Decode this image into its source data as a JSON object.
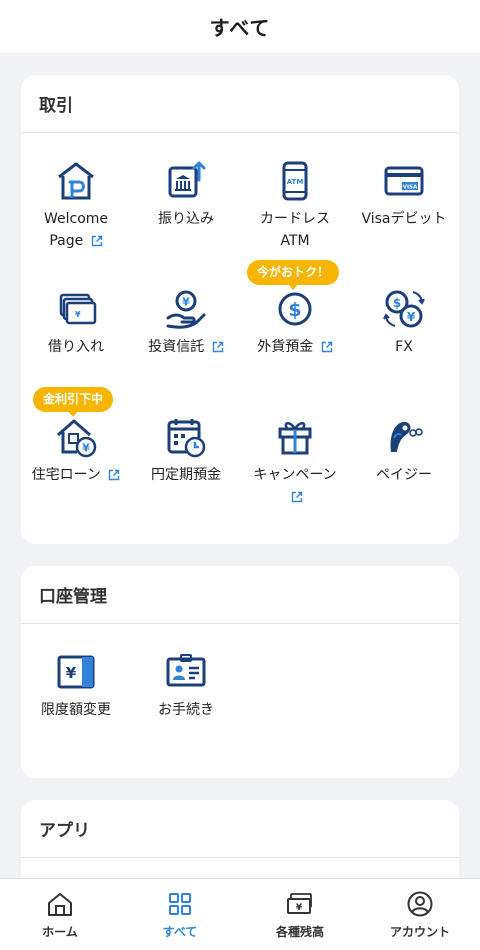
{
  "header": {
    "title": "すべて"
  },
  "transactions": {
    "title": "取引",
    "items": [
      {
        "line1": "Welcome",
        "line2": "Page",
        "icon": "welcome-page-icon",
        "external": true
      },
      {
        "line1": "振り込み",
        "icon": "transfer-icon"
      },
      {
        "line1": "カードレス",
        "line2": "ATM",
        "icon": "atm-phone-icon"
      },
      {
        "line1": "Visaデビット",
        "icon": "visa-card-icon"
      },
      {
        "line1": "借り入れ",
        "icon": "borrow-cards-icon"
      },
      {
        "line1": "投資信託",
        "icon": "investment-trust-icon",
        "external": true
      },
      {
        "line1": "外貨預金",
        "icon": "dollar-coin-icon",
        "external": true,
        "badge": "今がおトク！"
      },
      {
        "line1": "FX",
        "icon": "fx-exchange-icon"
      },
      {
        "line1": "住宅ローン",
        "icon": "house-yen-icon",
        "external": true,
        "badge": "金利引下中"
      },
      {
        "line1": "円定期預金",
        "icon": "calendar-clock-icon"
      },
      {
        "line1": "キャンペーン",
        "icon": "gift-icon",
        "external": true
      },
      {
        "line1": "ペイジー",
        "icon": "payeasy-bird-icon"
      }
    ]
  },
  "account": {
    "title": "口座管理",
    "items": [
      {
        "line1": "限度額変更",
        "icon": "limit-yen-icon"
      },
      {
        "line1": "お手続き",
        "icon": "id-card-icon"
      }
    ]
  },
  "apps": {
    "title": "アプリ"
  },
  "tabbar": {
    "tabs": [
      {
        "label": "ホーム",
        "icon": "home-icon"
      },
      {
        "label": "すべて",
        "icon": "grid-icon",
        "active": true
      },
      {
        "label": "各種残高",
        "icon": "balance-bills-icon"
      },
      {
        "label": "アカウント",
        "icon": "account-user-icon"
      }
    ]
  },
  "colors": {
    "primary": "#1b3f7a",
    "accent": "#2f83db",
    "badge": "#f7b500"
  }
}
